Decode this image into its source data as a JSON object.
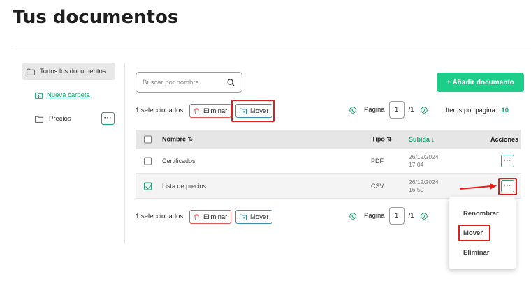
{
  "page": {
    "title": "Tus documentos"
  },
  "sidebar": {
    "all_docs": "Todos los documentos",
    "new_folder": "Nueva carpeta",
    "folders": [
      {
        "label": "Precios",
        "menu_label": "···"
      }
    ]
  },
  "search": {
    "placeholder": "Buscar por nombre"
  },
  "add_button": "+  Añadir documento",
  "action_bar": {
    "selected_text": "1 seleccionados",
    "delete_label": "Eliminar",
    "move_label": "Mover"
  },
  "pagination": {
    "page_label": "Página",
    "current_page": "1",
    "total": "/1",
    "per_page_label": "Ítems por página:",
    "per_page_value": "10"
  },
  "table": {
    "headers": {
      "name": "Nombre ⇅",
      "type": "Tipo ⇅",
      "uploaded": "Subida",
      "uploaded_sort": "↓",
      "actions": "Acciones"
    },
    "rows": [
      {
        "name": "Certificados",
        "type": "PDF",
        "date": "26/12/2024",
        "time": "17:04",
        "checked": false,
        "menu_label": "···"
      },
      {
        "name": "Lista de precios",
        "type": "CSV",
        "date": "26/12/2024",
        "time": "16:50",
        "checked": true,
        "menu_label": "···"
      }
    ]
  },
  "context_menu": {
    "items": [
      "Renombrar",
      "Mover",
      "Eliminar"
    ]
  },
  "colors": {
    "accent": "#1dcd8a",
    "accent_text": "#1aa577",
    "highlight": "#e01e1e"
  },
  "icons": {
    "folder": "folder-icon",
    "new_folder": "folder-plus-icon",
    "search": "search-icon",
    "trash": "trash-icon",
    "move": "folder-move-icon",
    "prev": "chevron-left-circle-icon",
    "next": "chevron-right-circle-icon",
    "more": "more-dots-icon"
  }
}
